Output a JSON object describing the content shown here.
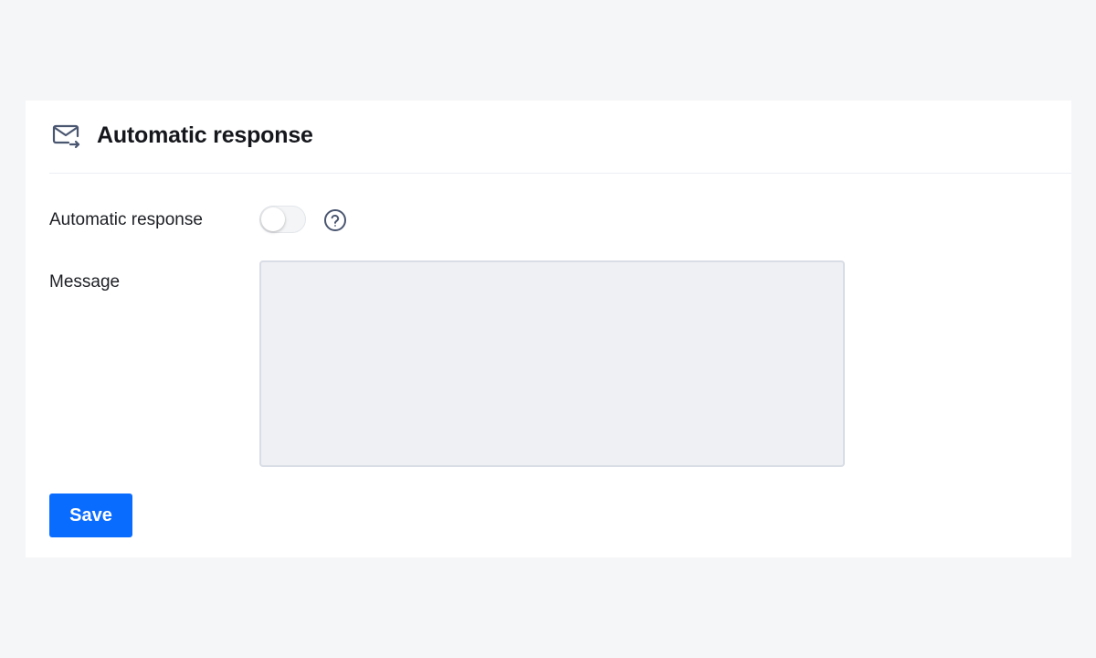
{
  "header": {
    "icon": "mail-forward-icon",
    "title": "Automatic response"
  },
  "form": {
    "auto_response": {
      "label": "Automatic response",
      "enabled": false,
      "help_icon": "question-circle-icon"
    },
    "message": {
      "label": "Message",
      "value": "",
      "placeholder": ""
    },
    "save_label": "Save"
  },
  "colors": {
    "page_background": "#f5f6f8",
    "card_background": "#ffffff",
    "accent": "#0a6cff",
    "icon": "#4a5670",
    "textarea_background": "#eff0f4",
    "textarea_border": "#d9dde5"
  }
}
